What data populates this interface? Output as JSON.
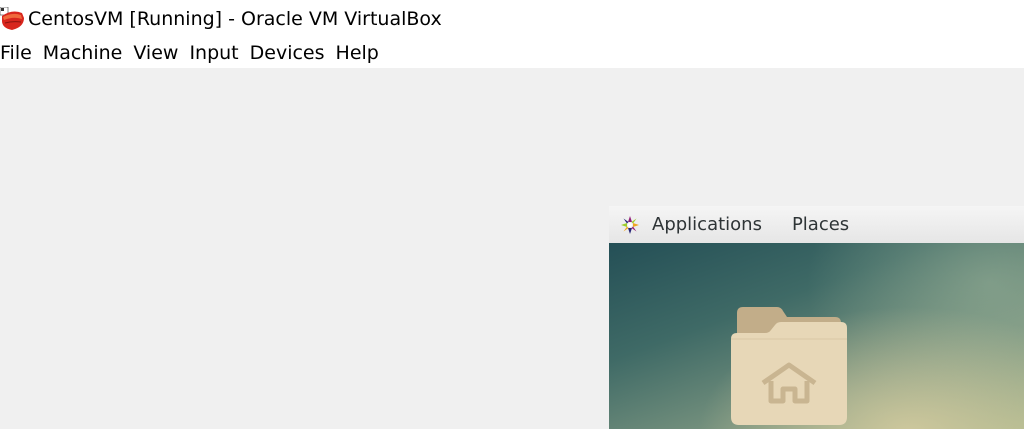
{
  "window": {
    "title": "CentosVM [Running] - Oracle VM VirtualBox",
    "app_icon": "virtualbox-icon"
  },
  "menubar": {
    "items": [
      {
        "label": "File"
      },
      {
        "label": "Machine"
      },
      {
        "label": "View"
      },
      {
        "label": "Input"
      },
      {
        "label": "Devices"
      },
      {
        "label": "Help"
      }
    ]
  },
  "guest": {
    "topbar": {
      "logo_icon": "gnome-foot-icon",
      "applications_label": "Applications",
      "places_label": "Places"
    },
    "desktop": {
      "home_folder_icon": "home-folder-icon"
    }
  },
  "colors": {
    "background": "#f0f0f0",
    "titlebar": "#ffffff",
    "guest_topbar": "#eeeeee"
  }
}
